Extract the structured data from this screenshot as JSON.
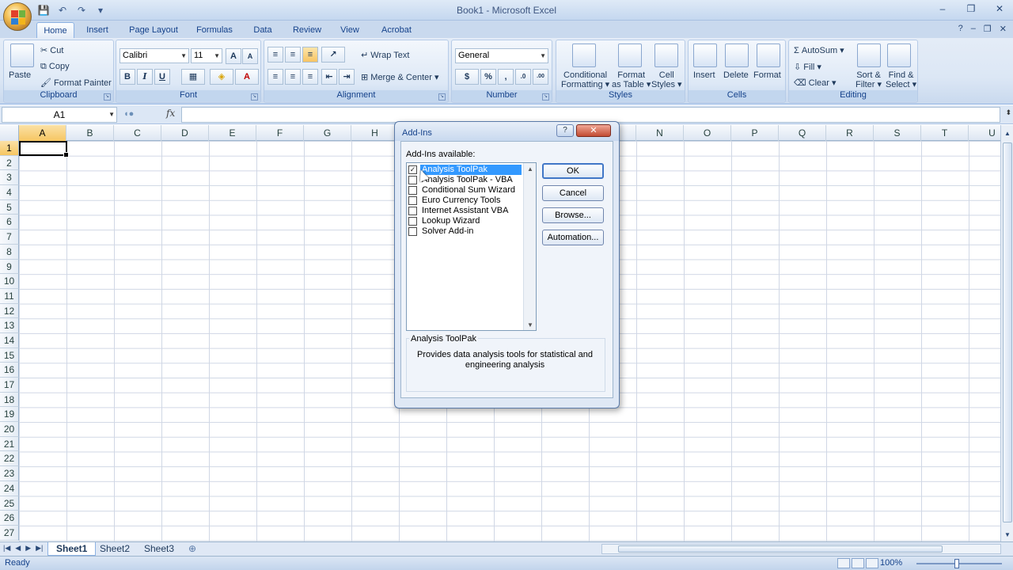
{
  "window": {
    "title": "Book1 - Microsoft Excel",
    "controls": [
      "–",
      "❐",
      "✕"
    ]
  },
  "qat": {
    "save": "💾",
    "undo": "↶",
    "redo": "↷",
    "customize": "▾"
  },
  "tabs": [
    "Home",
    "Insert",
    "Page Layout",
    "Formulas",
    "Data",
    "Review",
    "View",
    "Acrobat"
  ],
  "tab_right": {
    "help": "?",
    "minimize": "–",
    "restore": "❐",
    "close": "✕"
  },
  "ribbon": {
    "clipboard": {
      "label": "Clipboard",
      "paste": "Paste",
      "cut": "Cut",
      "copy": "Copy",
      "format_painter": "Format Painter"
    },
    "font": {
      "label": "Font",
      "name": "Calibri",
      "size": "11",
      "grow": "A",
      "shrink": "A",
      "bold": "B",
      "italic": "I",
      "underline": "U"
    },
    "alignment": {
      "label": "Alignment",
      "wrap_text": "Wrap Text",
      "merge_center": "Merge & Center"
    },
    "number": {
      "label": "Number",
      "format": "General",
      "currency": "$",
      "percent": "%",
      "comma": ",",
      "inc_dec": ".0",
      "dec_dec": ".00"
    },
    "styles": {
      "label": "Styles",
      "conditional_1": "Conditional",
      "conditional_2": "Formatting ▾",
      "table_1": "Format",
      "table_2": "as Table ▾",
      "cell_1": "Cell",
      "cell_2": "Styles ▾"
    },
    "cells": {
      "label": "Cells",
      "insert": "Insert",
      "delete": "Delete",
      "format": "Format"
    },
    "editing": {
      "label": "Editing",
      "autosum": "AutoSum",
      "fill": "Fill",
      "clear": "Clear",
      "sort_1": "Sort &",
      "sort_2": "Filter ▾",
      "find_1": "Find &",
      "find_2": "Select ▾"
    }
  },
  "formula_bar": {
    "name_box": "A1",
    "fx": "fx",
    "value": ""
  },
  "columns": [
    "A",
    "B",
    "C",
    "D",
    "E",
    "F",
    "G",
    "H",
    "I",
    "J",
    "K",
    "L",
    "M",
    "N",
    "O",
    "P",
    "Q",
    "R",
    "S",
    "T",
    "U"
  ],
  "rows": [
    "1",
    "2",
    "3",
    "4",
    "5",
    "6",
    "7",
    "8",
    "9",
    "10",
    "11",
    "12",
    "13",
    "14",
    "15",
    "16",
    "17",
    "18",
    "19",
    "20",
    "21",
    "22",
    "23",
    "24",
    "25",
    "26",
    "27"
  ],
  "sheets": [
    "Sheet1",
    "Sheet2",
    "Sheet3"
  ],
  "status": {
    "text": "Ready",
    "zoom": "100%"
  },
  "dialog": {
    "title": "Add-Ins",
    "help": "?",
    "close": "✕",
    "available_label": "Add-Ins available:",
    "items": [
      {
        "label": "Analysis ToolPak",
        "checked": true,
        "selected": true
      },
      {
        "label": "Analysis ToolPak - VBA",
        "checked": false,
        "selected": false
      },
      {
        "label": "Conditional Sum Wizard",
        "checked": false,
        "selected": false
      },
      {
        "label": "Euro Currency Tools",
        "checked": false,
        "selected": false
      },
      {
        "label": "Internet Assistant VBA",
        "checked": false,
        "selected": false
      },
      {
        "label": "Lookup Wizard",
        "checked": false,
        "selected": false
      },
      {
        "label": "Solver Add-in",
        "checked": false,
        "selected": false
      }
    ],
    "buttons": {
      "ok": "OK",
      "cancel": "Cancel",
      "browse": "Browse...",
      "automation": "Automation..."
    },
    "description_title": "Analysis ToolPak",
    "description": "Provides data analysis tools for statistical and engineering analysis"
  }
}
